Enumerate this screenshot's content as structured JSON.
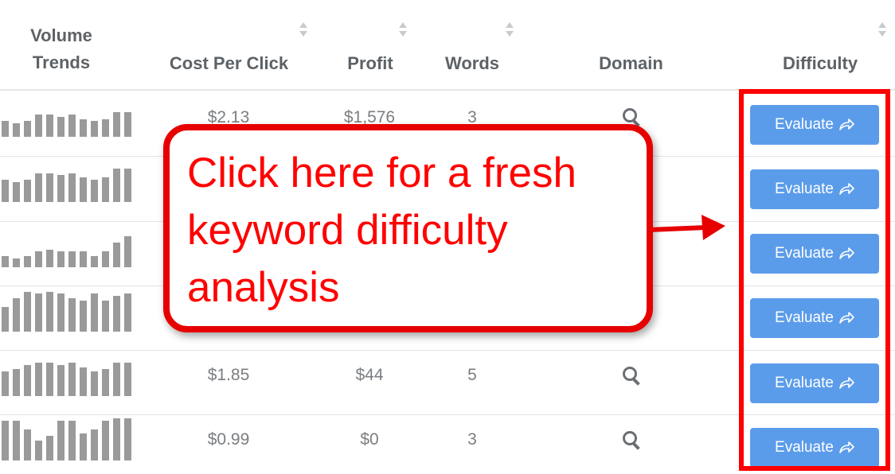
{
  "headers": {
    "volume_trends": "Volume\nTrends",
    "cost_per_click": "Cost Per Click",
    "profit": "Profit",
    "words": "Words",
    "domain": "Domain",
    "difficulty": "Difficulty"
  },
  "rows": [
    {
      "cpc": "$2.13",
      "profit": "$1,576",
      "words": "3",
      "trend": [
        0.35,
        0.3,
        0.35,
        0.5,
        0.5,
        0.45,
        0.5,
        0.4,
        0.35,
        0.4,
        0.55,
        0.55
      ],
      "button": "Evaluate"
    },
    {
      "cpc": "",
      "profit": "",
      "words": "",
      "trend": [
        0.5,
        0.45,
        0.5,
        0.65,
        0.65,
        0.6,
        0.65,
        0.55,
        0.5,
        0.55,
        0.75,
        0.75
      ],
      "button": "Evaluate"
    },
    {
      "cpc": "",
      "profit": "",
      "words": "",
      "trend": [
        0.25,
        0.2,
        0.25,
        0.35,
        0.4,
        0.35,
        0.35,
        0.35,
        0.25,
        0.35,
        0.55,
        0.7
      ],
      "button": "Evaluate"
    },
    {
      "cpc": "",
      "profit": "",
      "words": "",
      "trend": [
        0.55,
        0.75,
        0.9,
        0.85,
        0.9,
        0.85,
        0.75,
        0.7,
        0.85,
        0.7,
        0.8,
        0.85
      ],
      "button": "Evaluate"
    },
    {
      "cpc": "$1.85",
      "profit": "$44",
      "words": "5",
      "trend": [
        0.55,
        0.6,
        0.7,
        0.75,
        0.75,
        0.7,
        0.75,
        0.65,
        0.55,
        0.6,
        0.75,
        0.75
      ],
      "button": "Evaluate"
    },
    {
      "cpc": "$0.99",
      "profit": "$0",
      "words": "3",
      "trend": [
        0.9,
        0.9,
        0.7,
        0.45,
        0.55,
        0.9,
        0.9,
        0.6,
        0.7,
        0.9,
        0.95,
        0.95
      ],
      "button": "Evaluate"
    }
  ],
  "callout": {
    "text": "Click here for a fresh keyword difficulty analysis"
  },
  "colors": {
    "button": "#5b9cea",
    "highlight": "#ff0000",
    "trend_bar": "#9a9a9a"
  }
}
